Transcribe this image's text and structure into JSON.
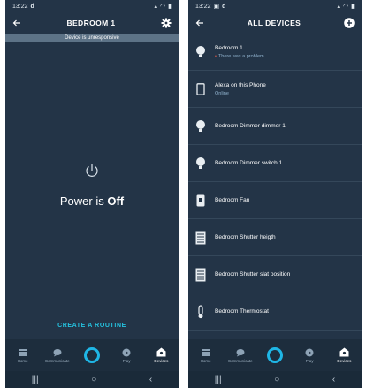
{
  "left": {
    "status": {
      "time": "13:22",
      "app_letter": "d"
    },
    "appbar": {
      "title": "BEDROOM 1"
    },
    "banner": "Device is unresponsive",
    "power": {
      "prefix": "Power is ",
      "state": "Off"
    },
    "routine_label": "CREATE A ROUTINE"
  },
  "right": {
    "status": {
      "time": "13:22",
      "app_letter": "d"
    },
    "appbar": {
      "title": "ALL DEVICES"
    },
    "devices": [
      {
        "name": "Bedroom 1",
        "status": "There was a problem",
        "icon": "bulb-icon"
      },
      {
        "name": "Alexa on this Phone",
        "status": "Online",
        "icon": "phone-icon"
      },
      {
        "name": "Bedroom Dimmer dimmer 1",
        "status": "",
        "icon": "bulb-icon"
      },
      {
        "name": "Bedroom Dimmer switch 1",
        "status": "",
        "icon": "bulb-icon"
      },
      {
        "name": "Bedroom Fan",
        "status": "",
        "icon": "plug-icon"
      },
      {
        "name": "Bedroom Shutter heigth",
        "status": "",
        "icon": "shutter-icon"
      },
      {
        "name": "Bedroom Shutter slat position",
        "status": "",
        "icon": "shutter-icon"
      },
      {
        "name": "Bedroom Thermostat",
        "status": "",
        "icon": "thermometer-icon"
      }
    ]
  },
  "nav": [
    {
      "label": "Home",
      "icon": "home-icon"
    },
    {
      "label": "Communicate",
      "icon": "chat-icon"
    },
    {
      "label": "",
      "icon": "alexa-icon"
    },
    {
      "label": "Play",
      "icon": "play-icon"
    },
    {
      "label": "Devices",
      "icon": "devices-icon",
      "active": true
    }
  ],
  "colors": {
    "background": "#233447",
    "accent": "#25c3e0",
    "banner": "#5d7387",
    "problem": "#e35b4b"
  }
}
